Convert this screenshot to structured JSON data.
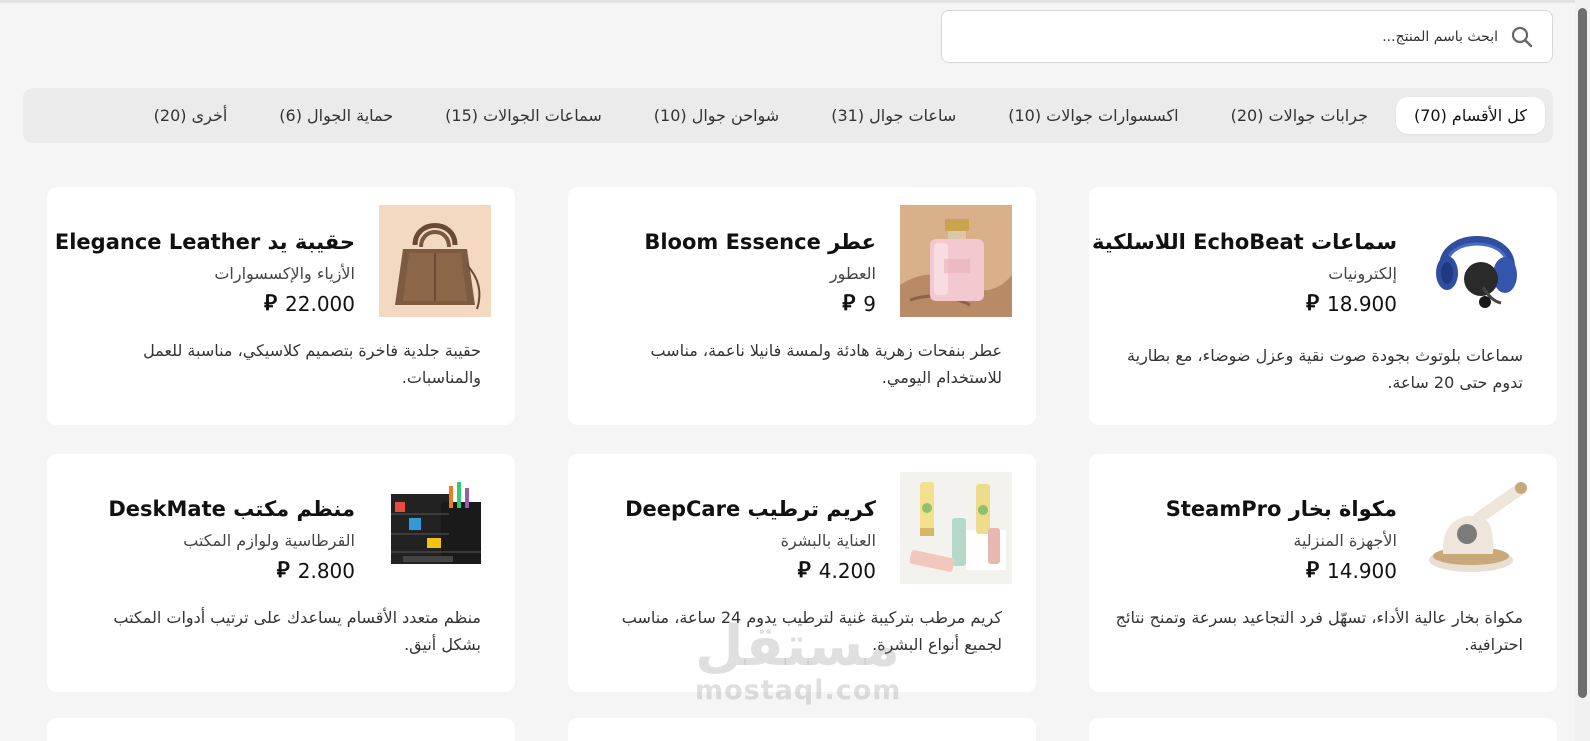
{
  "search": {
    "placeholder": "ابحث باسم المنتج...",
    "value": ""
  },
  "tabs": [
    {
      "label": "كل الأقسام (70)",
      "active": true
    },
    {
      "label": "جرابات جوالات (20)"
    },
    {
      "label": "اكسسوارات جوالات (10)"
    },
    {
      "label": "ساعات جوال (31)"
    },
    {
      "label": "شواحن جوال (10)"
    },
    {
      "label": "سماعات الجوالات (15)"
    },
    {
      "label": "حماية الجوال (6)"
    },
    {
      "label": "أخرى (20)"
    }
  ],
  "currency_symbol": "⃁",
  "products": [
    {
      "name": "سماعات EchoBeat اللاسلكية",
      "category": "إلكترونيات",
      "price": "18.900",
      "description": "سماعات بلوتوث بجودة صوت نقية وعزل ضوضاء، مع بطارية تدوم حتى 20 ساعة.",
      "image": "headphones-image"
    },
    {
      "name": "عطر Bloom Essence",
      "category": "العطور",
      "price": "9",
      "description": "عطر بنفحات زهرية هادئة ولمسة فانيلا ناعمة، مناسب للاستخدام اليومي.",
      "image": "perfume-image"
    },
    {
      "name": "حقيبة يد Elegance Leather",
      "category": "الأزياء والإكسسوارات",
      "price": "22.000",
      "description": "حقيبة جلدية فاخرة بتصميم كلاسيكي، مناسبة للعمل والمناسبات.",
      "image": "handbag-image"
    },
    {
      "name": "مكواة بخار SteamPro",
      "category": "الأجهزة المنزلية",
      "price": "14.900",
      "description": "مكواة بخار عالية الأداء، تسهّل فرد التجاعيد بسرعة وتمنح نتائج احترافية.",
      "image": "steam-iron-image"
    },
    {
      "name": "كريم ترطيب DeepCare",
      "category": "العناية بالبشرة",
      "price": "4.200",
      "description": "كريم مرطب بتركيبة غنية لترطيب يدوم 24 ساعة، مناسب لجميع أنواع البشرة.",
      "image": "cream-image"
    },
    {
      "name": "منظم مكتب DeskMate",
      "category": "القرطاسية ولوازم المكتب",
      "price": "2.800",
      "description": "منظم متعدد الأقسام يساعدك على ترتيب أدوات المكتب بشكل أنيق.",
      "image": "organizer-image"
    }
  ],
  "watermark": {
    "logo": "مستقل",
    "text": "mostaql.com"
  },
  "colors": {
    "background": "#f5f5f5",
    "card": "#ffffff",
    "tabs_bg": "#ebebeb",
    "text": "#1a1a1a"
  }
}
